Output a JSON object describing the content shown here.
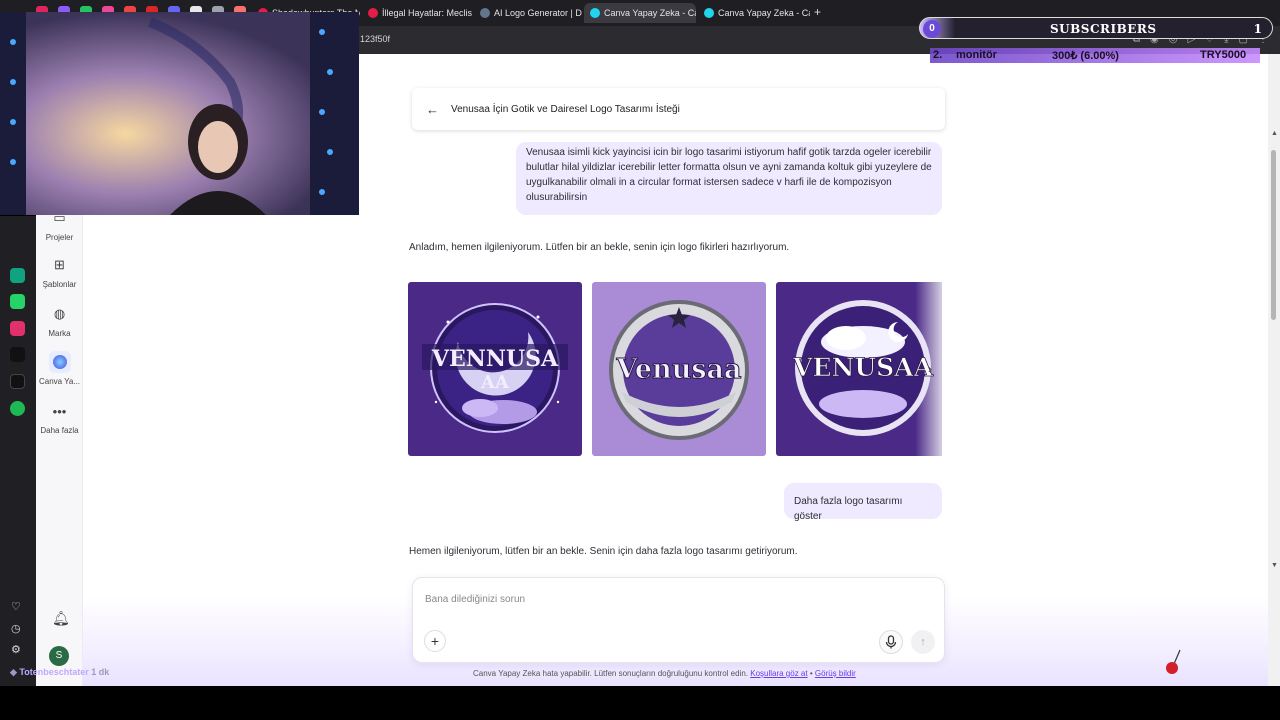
{
  "browser": {
    "tabs": [
      {
        "label": "Shadowhunters The Mo..."
      },
      {
        "label": "İllegal Hayatlar: Meclis | Fi..."
      },
      {
        "label": "AI Logo Generator | Desig..."
      },
      {
        "label": "Canva Yapay Zeka - Canva"
      },
      {
        "label": "Canva Yapay Zeka - Canva"
      }
    ],
    "new_tab": "+",
    "address_fragment": "123f50f"
  },
  "sidebar": {
    "items": [
      {
        "label": "Projeler",
        "icon": "folder-icon"
      },
      {
        "label": "Şablonlar",
        "icon": "templates-icon"
      },
      {
        "label": "Marka",
        "icon": "brand-icon"
      },
      {
        "label": "Canva Ya...",
        "icon": "canva-ai-icon"
      },
      {
        "label": "Daha fazla",
        "icon": "more-icon"
      }
    ],
    "avatar_initial": "S"
  },
  "chat": {
    "title": "Venusaa İçin Gotik ve Dairesel Logo Tasarımı İsteği",
    "user_message_1": "Venusaa isimli kick yayincisi icin bir logo tasarimi istiyorum hafif gotik tarzda ogeler icerebilir bulutlar hilal yildizlar icerebilir letter formatta olsun ve ayni zamanda koltuk gibi yuzeylere de uygulkanabilir olmali in a circular format istersen sadece v harfi ile de kompozisyon olusurabilirsin",
    "assistant_message_1": "Anladım, hemen ilgileniyorum. Lütfen bir an bekle, senin için logo fikirleri hazırlıyorum.",
    "logos": [
      {
        "text1": "VENNUSA",
        "text2": "AA"
      },
      {
        "text1": "Venusaa"
      },
      {
        "text1": "VENUSAA"
      }
    ],
    "user_message_2": "Daha fazla logo tasarımı göster",
    "assistant_message_2": "Hemen ilgileniyorum, lütfen bir an bekle. Senin için daha fazla logo tasarımı getiriyorum.",
    "composer_placeholder": "Bana dilediğinizi sorun",
    "footer_text": "Canva Yapay Zeka hata yapabilir. Lütfen sonuçların doğruluğunu kontrol edin.",
    "footer_link_1": "Koşullara göz at",
    "footer_separator": "•",
    "footer_link_2": "Görüş bildir"
  },
  "overlay": {
    "subs_count": "0",
    "subs_label": "SUBSCRIBERS",
    "subs_goal": "1",
    "ticker_rank": "2.",
    "ticker_name": "monitör",
    "ticker_value": "300₺ (6.00%)",
    "ticker_total": "TRY5000",
    "chat_user": "Totenbeschtater",
    "chat_time": "1 dk"
  },
  "colors": {
    "accent": "#6a3de8",
    "bubble": "#efeaff",
    "logo_bg_dark": "#4a2a86",
    "logo_bg_light": "#a98bd6"
  }
}
